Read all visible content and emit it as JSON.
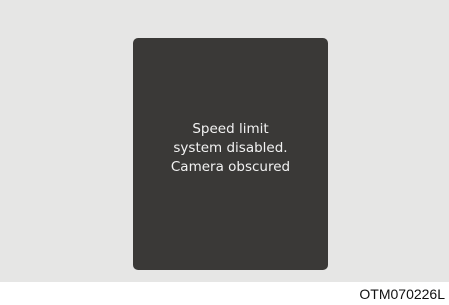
{
  "display": {
    "message_lines": [
      "Speed limit",
      "system disabled.",
      "Camera obscured"
    ]
  },
  "figure_code": "OTM070226L",
  "colors": {
    "background": "#e6e6e5",
    "screen": "#3a3937",
    "text": "#f2f2f2"
  }
}
